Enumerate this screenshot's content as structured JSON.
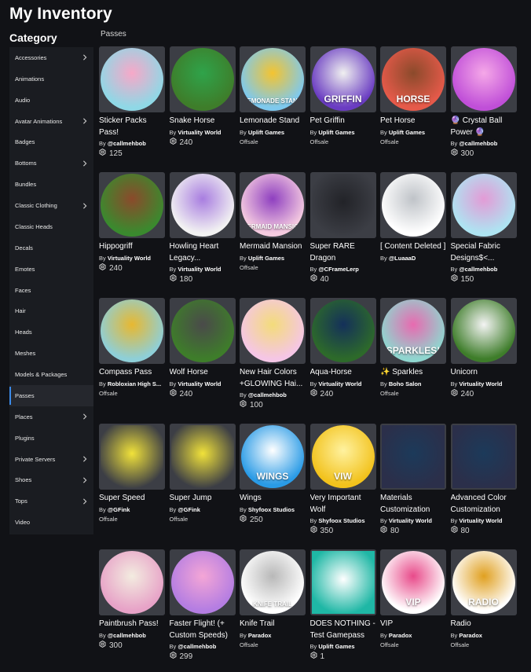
{
  "header": {
    "title": "My Inventory",
    "category_title": "Category"
  },
  "section_label": "Passes",
  "sidebar": {
    "items": [
      {
        "label": "Accessories",
        "chevron": true
      },
      {
        "label": "Animations",
        "chevron": false
      },
      {
        "label": "Audio",
        "chevron": false
      },
      {
        "label": "Avatar Animations",
        "chevron": true
      },
      {
        "label": "Badges",
        "chevron": false
      },
      {
        "label": "Bottoms",
        "chevron": true
      },
      {
        "label": "Bundles",
        "chevron": false
      },
      {
        "label": "Classic Clothing",
        "chevron": true
      },
      {
        "label": "Classic Heads",
        "chevron": false
      },
      {
        "label": "Decals",
        "chevron": false
      },
      {
        "label": "Emotes",
        "chevron": false
      },
      {
        "label": "Faces",
        "chevron": false
      },
      {
        "label": "Hair",
        "chevron": false
      },
      {
        "label": "Heads",
        "chevron": false
      },
      {
        "label": "Meshes",
        "chevron": false
      },
      {
        "label": "Models & Packages",
        "chevron": false
      },
      {
        "label": "Passes",
        "chevron": false,
        "active": true
      },
      {
        "label": "Places",
        "chevron": true
      },
      {
        "label": "Plugins",
        "chevron": false
      },
      {
        "label": "Private Servers",
        "chevron": true
      },
      {
        "label": "Shoes",
        "chevron": true
      },
      {
        "label": "Tops",
        "chevron": true
      },
      {
        "label": "Video",
        "chevron": false
      }
    ]
  },
  "items": [
    {
      "name": "Sticker Packs Pass!",
      "by": "By ",
      "creator": "@callmehbob",
      "price": "125",
      "offsale": "",
      "thumb": {
        "shape": "disc",
        "bg": "#8fd8e6",
        "accent": "#f7a8c8",
        "label": ""
      },
      "icon": "sticker-pack-thumbnail"
    },
    {
      "name": "Snake Horse",
      "by": "By ",
      "creator": "Virtuality World",
      "price": "240",
      "offsale": "",
      "thumb": {
        "shape": "disc",
        "bg": "#3e7d2a",
        "accent": "#2fa34a",
        "label": ""
      },
      "icon": "snake-horse-thumbnail"
    },
    {
      "name": "Lemonade Stand",
      "by": "By ",
      "creator": "Uplift Games",
      "price": "",
      "offsale": "Offsale",
      "thumb": {
        "shape": "disc",
        "bg": "#7ec9ee",
        "accent": "#f4c430",
        "label": "LEMONADE STAND"
      },
      "icon": "lemonade-stand-thumbnail"
    },
    {
      "name": "Pet Griffin",
      "by": "By ",
      "creator": "Uplift Games",
      "price": "",
      "offsale": "Offsale",
      "thumb": {
        "shape": "disc",
        "bg": "#6a3cc2",
        "accent": "#f0f0f0",
        "label": "GRIFFIN"
      },
      "icon": "griffin-thumbnail"
    },
    {
      "name": "Pet Horse",
      "by": "By ",
      "creator": "Uplift Games",
      "price": "",
      "offsale": "Offsale",
      "thumb": {
        "shape": "disc",
        "bg": "#e65a4a",
        "accent": "#8b4a2b",
        "label": "HORSE"
      },
      "icon": "horse-thumbnail"
    },
    {
      "name": "🔮 Crystal Ball Power 🔮",
      "by": "By ",
      "creator": "@callmehbob",
      "price": "300",
      "offsale": "",
      "thumb": {
        "shape": "disc",
        "bg": "#c04fd8",
        "accent": "#f5a8e8",
        "label": ""
      },
      "icon": "crystal-ball-thumbnail"
    },
    {
      "name": "Hippogriff",
      "by": "By ",
      "creator": "Virtuality World",
      "price": "240",
      "offsale": "",
      "thumb": {
        "shape": "disc",
        "bg": "#3a8a2e",
        "accent": "#8b4a2b",
        "label": ""
      },
      "icon": "hippogriff-thumbnail"
    },
    {
      "name": "Howling Heart Legacy...",
      "by": "By ",
      "creator": "Virtuality World",
      "price": "180",
      "offsale": "",
      "thumb": {
        "shape": "disc",
        "bg": "#f2f2f2",
        "accent": "#a87de0",
        "label": ""
      },
      "icon": "howling-wolf-thumbnail"
    },
    {
      "name": "Mermaid Mansion",
      "by": "By ",
      "creator": "Uplift Games",
      "price": "",
      "offsale": "Offsale",
      "thumb": {
        "shape": "disc",
        "bg": "#f5cbe0",
        "accent": "#8e3fc0",
        "label": "MERMAID MANSION"
      },
      "icon": "mermaid-mansion-thumbnail"
    },
    {
      "name": "Super RARE Dragon",
      "by": "By ",
      "creator": "@CFrameLerp",
      "price": "40",
      "offsale": "",
      "thumb": {
        "shape": "sq",
        "bg": "#3c3e45",
        "accent": "#222328",
        "label": ""
      },
      "icon": "dragon-thumbnail"
    },
    {
      "name": "[ Content Deleted ]",
      "by": "By ",
      "creator": "@LuaaaD",
      "price": "",
      "offsale": "",
      "thumb": {
        "shape": "disc",
        "bg": "#ffffff",
        "accent": "#bfc3c8",
        "label": ""
      },
      "icon": "content-deleted-thumbnail"
    },
    {
      "name": "Special Fabric Designs$<...",
      "by": "By ",
      "creator": "@callmehbob",
      "price": "150",
      "offsale": "",
      "thumb": {
        "shape": "disc",
        "bg": "#aee4f2",
        "accent": "#e39bd6",
        "label": ""
      },
      "icon": "fabric-designs-thumbnail"
    },
    {
      "name": "Compass Pass",
      "by": "By ",
      "creator": "Robloxian High S...",
      "price": "",
      "offsale": "Offsale",
      "thumb": {
        "shape": "disc",
        "bg": "#8ecfd8",
        "accent": "#e8b830",
        "label": ""
      },
      "icon": "compass-thumbnail"
    },
    {
      "name": "Wolf Horse",
      "by": "By ",
      "creator": "Virtuality World",
      "price": "240",
      "offsale": "",
      "thumb": {
        "shape": "disc",
        "bg": "#3e7d2a",
        "accent": "#4a4a4a",
        "label": ""
      },
      "icon": "wolf-horse-thumbnail"
    },
    {
      "name": "New Hair Colors +GLOWING Hai...",
      "by": "By ",
      "creator": "@callmehbob",
      "price": "100",
      "offsale": "",
      "thumb": {
        "shape": "disc",
        "bg": "#f5c6e6",
        "accent": "#f3dc7a",
        "label": ""
      },
      "icon": "hair-colors-thumbnail"
    },
    {
      "name": "Aqua-Horse",
      "by": "By ",
      "creator": "Virtuality World",
      "price": "240",
      "offsale": "",
      "thumb": {
        "shape": "disc",
        "bg": "#2d6a2a",
        "accent": "#14305a",
        "label": ""
      },
      "icon": "aqua-horse-thumbnail"
    },
    {
      "name": "✨ Sparkles",
      "by": "By ",
      "creator": "Boho Salon",
      "price": "",
      "offsale": "Offsale",
      "thumb": {
        "shape": "disc",
        "bg": "#8fd6cf",
        "accent": "#e86ab0",
        "label": "SPARKLES!"
      },
      "icon": "sparkles-thumbnail"
    },
    {
      "name": "Unicorn",
      "by": "By ",
      "creator": "Virtuality World",
      "price": "240",
      "offsale": "",
      "thumb": {
        "shape": "disc",
        "bg": "#3e7d2a",
        "accent": "#f4f4f4",
        "label": ""
      },
      "icon": "unicorn-thumbnail"
    },
    {
      "name": "Super Speed",
      "by": "By ",
      "creator": "@GFink",
      "price": "",
      "offsale": "Offsale",
      "thumb": {
        "shape": "sq",
        "bg": "#3c3e45",
        "accent": "#f1e23a",
        "label": ""
      },
      "icon": "super-speed-thumbnail"
    },
    {
      "name": "Super Jump",
      "by": "By ",
      "creator": "@GFink",
      "price": "",
      "offsale": "Offsale",
      "thumb": {
        "shape": "sq",
        "bg": "#3c3e45",
        "accent": "#f1e23a",
        "label": ""
      },
      "icon": "super-jump-thumbnail"
    },
    {
      "name": "Wings",
      "by": "By ",
      "creator": "Shyfoox Studios",
      "price": "250",
      "offsale": "",
      "thumb": {
        "shape": "disc",
        "bg": "#2a9be6",
        "accent": "#ffffff",
        "label": "WINGS"
      },
      "icon": "wings-thumbnail"
    },
    {
      "name": "Very Important Wolf",
      "by": "By ",
      "creator": "Shyfoox Studios",
      "price": "350",
      "offsale": "",
      "thumb": {
        "shape": "disc",
        "bg": "#f2c21c",
        "accent": "#fff2a0",
        "label": "VIW"
      },
      "icon": "viw-thumbnail"
    },
    {
      "name": "Materials Customization",
      "by": "By ",
      "creator": "Virtuality World",
      "price": "80",
      "offsale": "",
      "thumb": {
        "shape": "sq",
        "bg": "#2b2f4a",
        "accent": "#1c3a5a",
        "label": ""
      },
      "icon": "materials-horse-thumbnail"
    },
    {
      "name": "Advanced Color Customization",
      "by": "By ",
      "creator": "Virtuality World",
      "price": "80",
      "offsale": "",
      "thumb": {
        "shape": "sq",
        "bg": "#2b2f4a",
        "accent": "#1c3a5a",
        "label": ""
      },
      "icon": "color-horse-thumbnail"
    },
    {
      "name": "Paintbrush Pass!",
      "by": "By ",
      "creator": "@callmehbob",
      "price": "300",
      "offsale": "",
      "thumb": {
        "shape": "disc",
        "bg": "#e7a2c7",
        "accent": "#f3ece0",
        "label": ""
      },
      "icon": "paintbrush-thumbnail"
    },
    {
      "name": "Faster Flight! (+ Custom Speeds)",
      "by": "By ",
      "creator": "@callmehbob",
      "price": "299",
      "offsale": "",
      "thumb": {
        "shape": "disc",
        "bg": "#b47de2",
        "accent": "#f4a6d6",
        "label": ""
      },
      "icon": "fairy-thumbnail"
    },
    {
      "name": "Knife Trail",
      "by": "By ",
      "creator": "Paradox",
      "price": "",
      "offsale": "Offsale",
      "thumb": {
        "shape": "disc",
        "bg": "#ffffff",
        "accent": "#b8b8b8",
        "label": "KNIFE TRAIL"
      },
      "icon": "knife-trail-thumbnail"
    },
    {
      "name": "DOES NOTHING - Test Gamepass",
      "by": "By ",
      "creator": "Uplift Games",
      "price": "1",
      "offsale": "",
      "thumb": {
        "shape": "sq",
        "bg": "#1fb7a5",
        "accent": "#ffffff",
        "label": ""
      },
      "icon": "gear-thumbnail"
    },
    {
      "name": "VIP",
      "by": "By ",
      "creator": "Paradox",
      "price": "",
      "offsale": "Offsale",
      "thumb": {
        "shape": "disc",
        "bg": "#ffffff",
        "accent": "#e84a8a",
        "label": "VIP"
      },
      "icon": "vip-thumbnail"
    },
    {
      "name": "Radio",
      "by": "By ",
      "creator": "Paradox",
      "price": "",
      "offsale": "Offsale",
      "thumb": {
        "shape": "disc",
        "bg": "#ffffff",
        "accent": "#e0a020",
        "label": "RADIO"
      },
      "icon": "radio-thumbnail"
    }
  ],
  "colors": {
    "background": "#111216",
    "sidebar": "#1a1c21",
    "thumb_bg": "#3c3e45",
    "active_indicator": "#3b8bea"
  }
}
